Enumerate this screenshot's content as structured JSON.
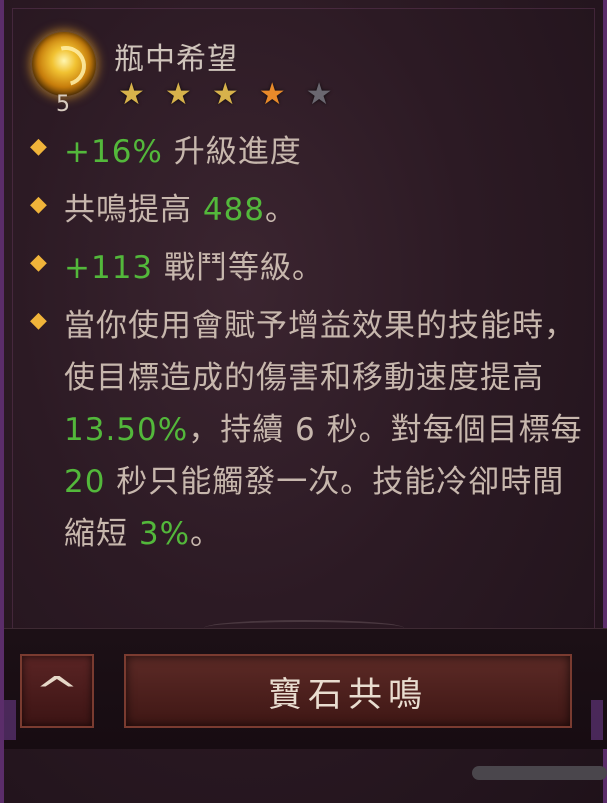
{
  "gem": {
    "name": "瓶中希望",
    "rank": "5",
    "icon": "golden-swirl-gem-icon",
    "stars": [
      "gold",
      "gold",
      "gold",
      "orange",
      "gray"
    ]
  },
  "affixes": [
    {
      "parts": [
        {
          "text": "+16%",
          "green": true
        },
        {
          "text": " 升級進度",
          "green": false
        }
      ]
    },
    {
      "parts": [
        {
          "text": "共鳴提高 ",
          "green": false
        },
        {
          "text": "488",
          "green": true
        },
        {
          "text": "。",
          "green": false
        }
      ]
    },
    {
      "parts": [
        {
          "text": "+113",
          "green": true
        },
        {
          "text": " 戰鬥等級。",
          "green": false
        }
      ]
    },
    {
      "parts": [
        {
          "text": "當你使用會賦予增益效果的技能時，使目標造成的傷害和移動速度提高 ",
          "green": false
        },
        {
          "text": "13.50%",
          "green": true
        },
        {
          "text": "，持續 6 秒。對每個目標每 ",
          "green": false
        },
        {
          "text": "20",
          "green": true
        },
        {
          "text": " 秒只能觸發一次。技能冷卻時間縮短 ",
          "green": false
        },
        {
          "text": "3%",
          "green": true
        },
        {
          "text": "。",
          "green": false
        }
      ]
    }
  ],
  "buttons": {
    "collapse_icon": "chevron-up-icon",
    "collapse_glyph": "^",
    "gem_resonance_label": "寶石共鳴"
  },
  "colors": {
    "value_green": "#53b83b",
    "bullet_gold": "#f0b43a",
    "star_gold": "#d7b24b",
    "star_orange": "#e88a2a",
    "star_gray": "#6a6770"
  }
}
